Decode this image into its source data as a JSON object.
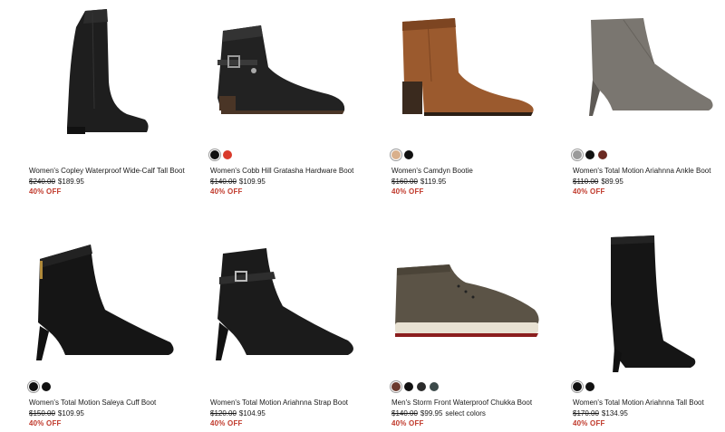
{
  "products": [
    {
      "name": "Women's Copley Waterproof Wide-Calf Tall Boot",
      "original_price": "$240.00",
      "sale_price": "$189.95",
      "extra": "",
      "discount": "40% OFF",
      "image_icon": "tall-boot-black",
      "swatches": []
    },
    {
      "name": "Women's Cobb Hill Gratasha Hardware Boot",
      "original_price": "$140.00",
      "sale_price": "$109.95",
      "extra": "",
      "discount": "40% OFF",
      "image_icon": "buckle-ankle-boot-black",
      "swatches": [
        "#111111",
        "#d93a2b"
      ]
    },
    {
      "name": "Women's Camdyn Bootie",
      "original_price": "$160.00",
      "sale_price": "$119.95",
      "extra": "",
      "discount": "40% OFF",
      "image_icon": "bootie-cognac",
      "swatches": [
        "#d9b08c",
        "#111111"
      ]
    },
    {
      "name": "Women's Total Motion Ariahnna Ankle Boot",
      "original_price": "$110.00",
      "sale_price": "$89.95",
      "extra": "",
      "discount": "40% OFF",
      "image_icon": "heeled-ankle-boot-grey",
      "swatches": [
        "#9a9a9a",
        "#111111",
        "#6b2a22"
      ]
    },
    {
      "name": "Women's Total Motion Saleya Cuff Boot",
      "original_price": "$150.00",
      "sale_price": "$109.95",
      "extra": "",
      "discount": "40% OFF",
      "image_icon": "cuff-boot-black",
      "swatches": [
        "#111111",
        "#111111"
      ]
    },
    {
      "name": "Women's Total Motion Ariahnna Strap Boot",
      "original_price": "$120.00",
      "sale_price": "$104.95",
      "extra": "",
      "discount": "40% OFF",
      "image_icon": "strap-boot-black",
      "swatches": []
    },
    {
      "name": "Men's Storm Front Waterproof Chukka Boot",
      "original_price": "$140.00",
      "sale_price": "$99.95",
      "extra": "select colors",
      "discount": "40% OFF",
      "image_icon": "chukka-boot-olive",
      "swatches": [
        "#6b3a2e",
        "#111111",
        "#2a2a2a",
        "#3c4a4a"
      ]
    },
    {
      "name": "Women's Total Motion Ariahnna Tall Boot",
      "original_price": "$170.00",
      "sale_price": "$134.95",
      "extra": "",
      "discount": "40% OFF",
      "image_icon": "tall-heeled-boot-black",
      "swatches": [
        "#111111",
        "#111111"
      ]
    }
  ],
  "colors": {
    "discount": "#c0392b",
    "text": "#1a1a1a"
  }
}
